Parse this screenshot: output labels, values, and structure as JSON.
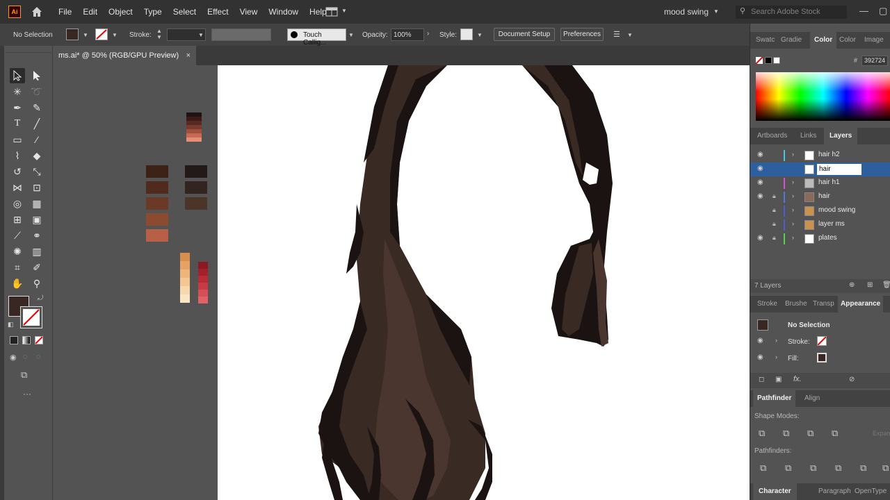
{
  "menubar": {
    "logo": "Ai",
    "items": [
      "File",
      "Edit",
      "Object",
      "Type",
      "Select",
      "Effect",
      "View",
      "Window",
      "Help"
    ],
    "workspace": "mood swing",
    "search_placeholder": "Search Adobe Stock"
  },
  "controlbar": {
    "selection": "No Selection",
    "stroke_label": "Stroke:",
    "brush": "Touch Callig...",
    "opacity_label": "Opacity:",
    "opacity_value": "100%",
    "style_label": "Style:",
    "document_setup": "Document Setup",
    "preferences": "Preferences"
  },
  "document_tab": {
    "title": "ms.ai* @ 50% (RGB/GPU Preview)",
    "close": "×"
  },
  "color_panel": {
    "tabs": [
      "Swatc",
      "Gradie",
      "Color",
      "Color",
      "Image"
    ],
    "active_tab": "Color",
    "hex_label": "#",
    "hex_value": "392724"
  },
  "layers_panel": {
    "tabs": [
      "Artboards",
      "Links",
      "Layers"
    ],
    "active_tab": "Layers",
    "layers": [
      {
        "name": "hair h2",
        "color": "#41c8e0",
        "locked": false,
        "visible": true
      },
      {
        "name": "hair",
        "color": "#2d5e9e",
        "locked": false,
        "visible": true,
        "editing": true
      },
      {
        "name": "hair h1",
        "color": "#d44fd6",
        "locked": false,
        "visible": true
      },
      {
        "name": "hair",
        "color": "#4f7ad6",
        "locked": true,
        "visible": true
      },
      {
        "name": "mood swing",
        "color": "#4f5ad6",
        "locked": true,
        "visible": false
      },
      {
        "name": "layer ms",
        "color": "#4f5ad6",
        "locked": true,
        "visible": false
      },
      {
        "name": "plates",
        "color": "#4fd64f",
        "locked": true,
        "visible": true
      }
    ],
    "count": "7 Layers"
  },
  "appearance_panel": {
    "tabs": [
      "Stroke",
      "Brushe",
      "Transp",
      "Appearance"
    ],
    "active_tab": "Appearance",
    "title": "No Selection",
    "stroke_label": "Stroke:",
    "fill_label": "Fill:"
  },
  "pathfinder_panel": {
    "tabs": [
      "Pathfinder",
      "Align"
    ],
    "active_tab": "Pathfinder",
    "shape_modes": "Shape Modes:",
    "pathfinders": "Pathfinders:",
    "expand": "Expand"
  },
  "bottom_tabs": [
    "Character",
    "Paragraph",
    "OpenType"
  ],
  "colors": {
    "hair_dark": "#1a1312",
    "hair_mid": "#3a2a24",
    "hair_light": "#4a362e",
    "fill_swatch": "#392724"
  },
  "palettes": {
    "browns_tall": [
      "#3d2218",
      "#4f2a1d",
      "#6b3a26",
      "#8c4a2e",
      "#b86047"
    ],
    "darks": [
      "#221a18",
      "#32241f",
      "#4a3528"
    ],
    "top_strip": [
      "#201212",
      "#3b1b18",
      "#5a2a22",
      "#7a3a2c",
      "#a0503c",
      "#c46a55",
      "#e58d76"
    ],
    "peach_strip": [
      "#d88f4e",
      "#e6a264",
      "#eeb57a",
      "#f3c793",
      "#f7d7ac",
      "#f9e4c4"
    ],
    "red_strip": [
      "#8c1824",
      "#a4202e",
      "#b82c38",
      "#c83a44",
      "#d64e56",
      "#e06268"
    ]
  }
}
